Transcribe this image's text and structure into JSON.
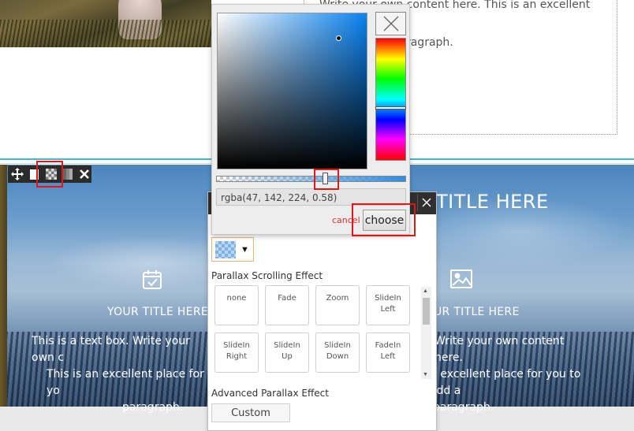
{
  "top": {
    "paragraph_line1": "Write your own content here. This is an excellent place",
    "paragraph_line2": "you to add a paragraph."
  },
  "section": {
    "title_right": "TITLE HERE",
    "col1": {
      "icon": "calendar-check-icon",
      "title": "YOUR TITLE HERE",
      "body_line1": "This is a text box. Write your own c",
      "body_line2": "This is an excellent place for yo",
      "body_line3": "paragraph."
    },
    "col3": {
      "icon": "image-icon",
      "title": "UR TITLE HERE",
      "body_line1": "Write your own content here.",
      "body_line2": "n excellent place for you to add a",
      "body_line3": "paragraph."
    }
  },
  "toolbar": {
    "icons": [
      "move-icon",
      "column-icon",
      "background-icon",
      "columns-icon",
      "close-icon"
    ]
  },
  "color_picker": {
    "value": "rgba(47, 142, 224, 0.58)",
    "alpha": 0.58,
    "cancel_label": "cancel",
    "choose_label": "choose",
    "colors": {
      "selected": "#2f8ee0"
    }
  },
  "panel": {
    "parallax_label": "Parallax Scrolling Effect",
    "effects": [
      {
        "line1": "none",
        "line2": ""
      },
      {
        "line1": "Fade",
        "line2": ""
      },
      {
        "line1": "Zoom",
        "line2": ""
      },
      {
        "line1": "SlideIn",
        "line2": "Left"
      },
      {
        "line1": "SlideIn",
        "line2": "Right"
      },
      {
        "line1": "SlideIn",
        "line2": "Up"
      },
      {
        "line1": "SlideIn",
        "line2": "Down"
      },
      {
        "line1": "FadeIn",
        "line2": "Left"
      }
    ],
    "advanced_label": "Advanced Parallax Effect",
    "custom_label": "Custom"
  }
}
